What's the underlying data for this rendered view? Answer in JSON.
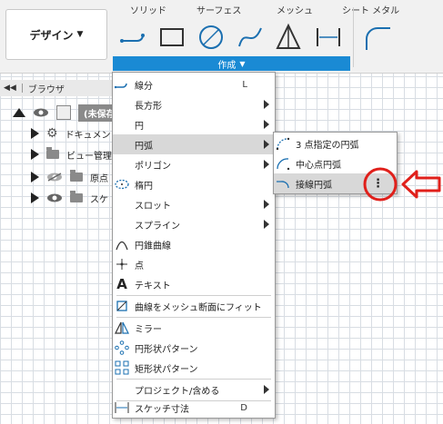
{
  "toolbar": {
    "design_label": "デザイン",
    "tabs": [
      "ソリッド",
      "サーフェス",
      "メッシュ",
      "シート メタル"
    ],
    "create_label": "作成",
    "tools": [
      "line-tool-icon",
      "rectangle-tool-icon",
      "circle-tool-icon",
      "spline-tool-icon",
      "triangle-tool-icon",
      "dimension-tool-icon",
      "fillet-tool-icon"
    ]
  },
  "browser": {
    "title": "ブラウザ",
    "rows": [
      {
        "label": "(未保存"
      },
      {
        "label": "ドキュメン"
      },
      {
        "label": "ビュー管理"
      },
      {
        "label": "原点"
      },
      {
        "label": "スケ"
      }
    ]
  },
  "menu": {
    "items": [
      {
        "label": "線分",
        "shortcut": "L",
        "icon": "line-icon"
      },
      {
        "label": "長方形",
        "submenu": true
      },
      {
        "label": "円",
        "submenu": true
      },
      {
        "label": "円弧",
        "submenu": true,
        "highlight": true
      },
      {
        "label": "ポリゴン",
        "submenu": true
      },
      {
        "label": "楕円",
        "icon": "ellipse-icon"
      },
      {
        "label": "スロット",
        "submenu": true
      },
      {
        "label": "スプライン",
        "submenu": true
      },
      {
        "label": "円錐曲線",
        "icon": "conic-icon"
      },
      {
        "label": "点",
        "icon": "point-icon"
      },
      {
        "label": "テキスト",
        "icon": "text-icon"
      },
      {
        "label": "曲線をメッシュ断面にフィット",
        "icon": "mesh-fit-icon"
      },
      {
        "label": "ミラー",
        "icon": "mirror-icon"
      },
      {
        "label": "円形状パターン",
        "icon": "circular-pattern-icon"
      },
      {
        "label": "矩形状パターン",
        "icon": "rect-pattern-icon"
      },
      {
        "label": "プロジェクト/含める",
        "submenu": true
      },
      {
        "label": "スケッチ寸法",
        "shortcut": "D",
        "icon": "sketch-dimension-icon"
      }
    ]
  },
  "submenu": {
    "items": [
      {
        "label": "3 点指定の円弧"
      },
      {
        "label": "中心点円弧"
      },
      {
        "label": "接線円弧",
        "highlight": true
      }
    ],
    "more_glyph": "⋮"
  },
  "colors": {
    "accent": "#1a8ad4",
    "annotation": "#e0201b"
  }
}
